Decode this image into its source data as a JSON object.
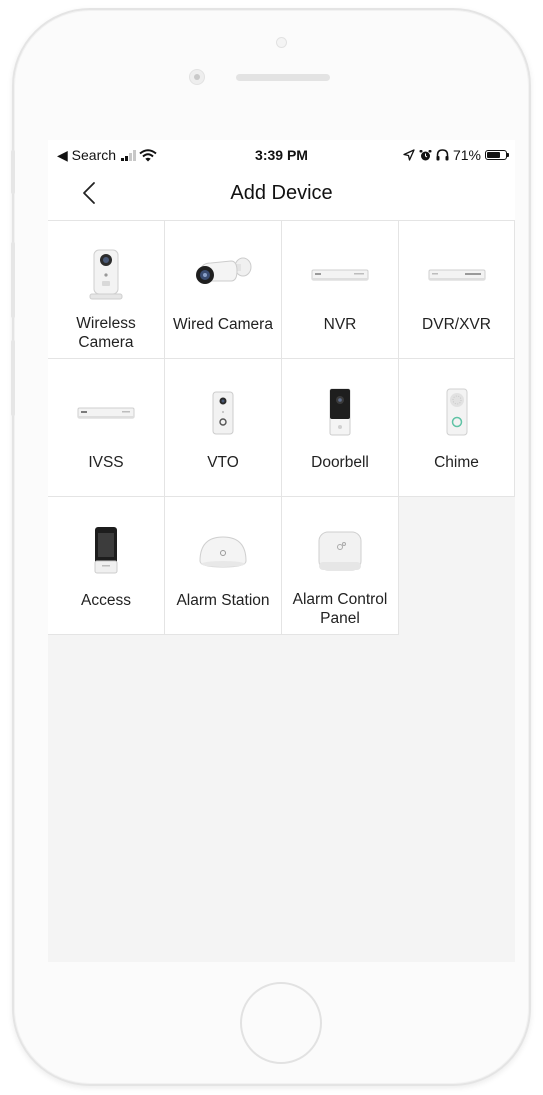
{
  "status_bar": {
    "back_app": "◀ Search",
    "time": "3:39 PM",
    "battery": "71%"
  },
  "nav": {
    "title": "Add Device"
  },
  "devices": [
    {
      "line1": "Wireless",
      "line2": "Camera",
      "icon": "wireless-camera-icon"
    },
    {
      "line1": "Wired Camera",
      "line2": "",
      "icon": "bullet-camera-icon"
    },
    {
      "line1": "NVR",
      "line2": "",
      "icon": "nvr-recorder-icon"
    },
    {
      "line1": "DVR/XVR",
      "line2": "",
      "icon": "dvr-recorder-icon"
    },
    {
      "line1": "IVSS",
      "line2": "",
      "icon": "ivss-recorder-icon"
    },
    {
      "line1": "VTO",
      "line2": "",
      "icon": "vto-intercom-icon"
    },
    {
      "line1": "Doorbell",
      "line2": "",
      "icon": "doorbell-icon"
    },
    {
      "line1": "Chime",
      "line2": "",
      "icon": "chime-icon"
    },
    {
      "line1": "Access",
      "line2": "",
      "icon": "access-terminal-icon"
    },
    {
      "line1": "Alarm Station",
      "line2": "",
      "icon": "alarm-station-icon"
    },
    {
      "line1": "Alarm Control",
      "line2": "Panel",
      "icon": "alarm-control-panel-icon"
    }
  ]
}
